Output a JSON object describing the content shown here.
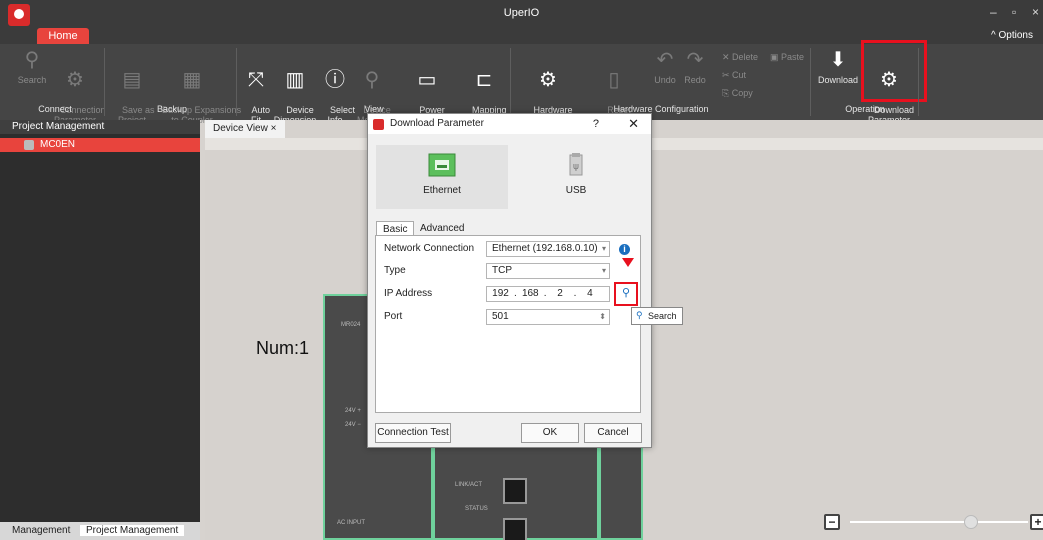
{
  "app": {
    "title": "UperIO"
  },
  "tabs": {
    "home": "Home",
    "options": "Options"
  },
  "ribbon": {
    "search": "Search",
    "connection_parameter": "Connection\nParameter",
    "group_connect": "Connect",
    "save_as_project": "Save as\nProject",
    "backup_expansions": "Backup Expansions\nto Coupler",
    "group_backup": "Backup",
    "auto_fit": "Auto\nFit",
    "device_dimension": "Device\nDimension",
    "select_info": "Select\nInfo",
    "device_monitor": "Device\nMonitor",
    "power_consumption": "Power\nConsumption",
    "mapping_table": "Mapping\nTable",
    "group_view": "View",
    "hardware_configuration": "Hardware\nConfiguration",
    "reset_configuration": "Reset\nConfiguration",
    "undo": "Undo",
    "redo": "Redo",
    "delete": "Delete",
    "paste": "Paste",
    "cut": "Cut",
    "copy": "Copy",
    "group_hardware_configuration": "Hardware Configuration",
    "download": "Download",
    "download_parameter": "Download\nParameter",
    "group_operation": "Operation"
  },
  "left_panel": {
    "header": "Project Management",
    "items": [
      "MC0EN"
    ],
    "bottom_tabs": [
      "Management",
      "Project Management"
    ]
  },
  "document": {
    "tab": "Device View ×",
    "num_label": "Num:1"
  },
  "dialog": {
    "title": "Download Parameter",
    "help": "?",
    "close": "✕",
    "options": [
      "Ethernet",
      "USB"
    ],
    "tabs": [
      "Basic",
      "Advanced"
    ],
    "fields": {
      "network_connection_label": "Network Connection",
      "network_connection_value": "Ethernet (192.168.0.10)",
      "type_label": "Type",
      "type_value": "TCP",
      "ip_label": "IP Address",
      "ip_octets": [
        "192",
        "168",
        "2",
        "4"
      ],
      "port_label": "Port",
      "port_value": "501"
    },
    "buttons": {
      "connection_test": "Connection Test",
      "ok": "OK",
      "cancel": "Cancel"
    },
    "tooltip": "Search"
  },
  "colors": {
    "accent": "#e8443d",
    "highlight": "#e8101e",
    "ribbon_bg": "#454545",
    "info": "#1a6fbf"
  }
}
